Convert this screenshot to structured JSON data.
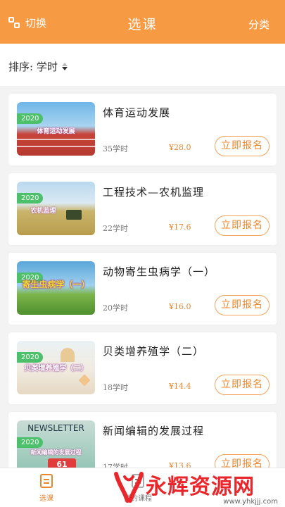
{
  "header": {
    "switch_label": "切换",
    "title": "选课",
    "category_label": "分类"
  },
  "sort": {
    "label": "排序: 学时"
  },
  "courses": [
    {
      "year": "2020",
      "title": "体育运动发展",
      "thumb_text": "体育运动发展",
      "hours": "35学时",
      "price": "¥28.0",
      "button": "立即报名"
    },
    {
      "year": "2020",
      "title": "工程技术—农机监理",
      "thumb_text": "农机监理",
      "hours": "22学时",
      "price": "¥17.6",
      "button": "立即报名"
    },
    {
      "year": "2020",
      "title": "动物寄生虫病学（一）",
      "thumb_text": "寄生虫病学（一）",
      "hours": "20学时",
      "price": "¥16.0",
      "button": "立即报名"
    },
    {
      "year": "2020",
      "title": "贝类增养殖学（二）",
      "thumb_text": "贝类增养殖学（二）",
      "hours": "18学时",
      "price": "¥14.4",
      "button": "立即报名"
    },
    {
      "year": "2020",
      "title": "新闻编辑的发展过程",
      "thumb_text": "新闻编辑的发展过程",
      "thumb_header": "NEWSLETTER",
      "hours": "17学时",
      "price": "¥13.6",
      "button": "立即报名"
    }
  ],
  "tabs": [
    {
      "label": "选课",
      "icon": "course-icon"
    },
    {
      "label": "我的课程",
      "icon": "my-course-icon"
    }
  ],
  "watermark": {
    "text": "永辉资源网",
    "url": "www.yhkjjj.com"
  },
  "colors": {
    "accent": "#f79a44",
    "price": "#e8872e",
    "badge": "#4cc06a",
    "watermark": "#e8262b"
  }
}
